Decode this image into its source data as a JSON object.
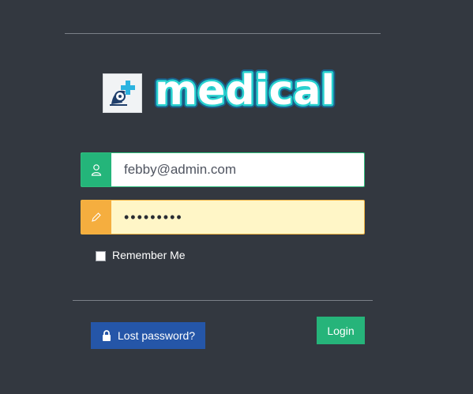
{
  "logo": {
    "wordmark": "medical",
    "icon": "medical-cross-bird-icon"
  },
  "form": {
    "email": {
      "value": "febby@admin.com",
      "icon": "user-icon"
    },
    "password": {
      "value": "•••••••••",
      "icon": "pencil-icon"
    },
    "remember_label": "Remember Me",
    "remember_checked": false
  },
  "actions": {
    "lost_password_label": "Lost password?",
    "lost_password_icon": "lock-icon",
    "login_label": "Login"
  },
  "colors": {
    "background": "#333840",
    "email_accent": "#24b57a",
    "password_accent": "#f5ae3f",
    "password_fill": "#fff6c7",
    "lost_button": "#2556a8",
    "login_button": "#26b47a",
    "logo_teal": "#22c6c9"
  }
}
